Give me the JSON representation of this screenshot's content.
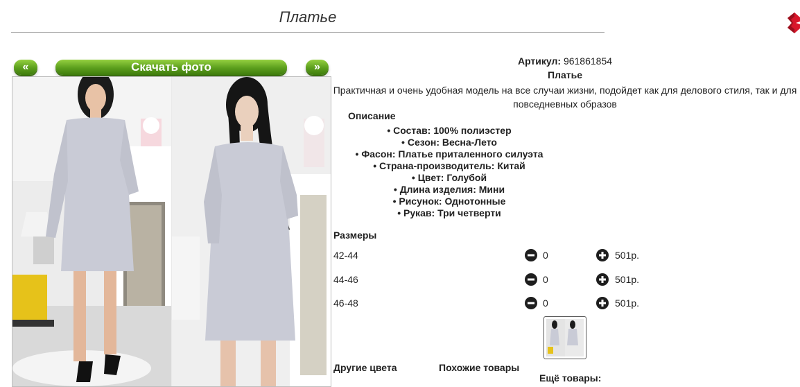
{
  "header": {
    "title": "Платье"
  },
  "gallery": {
    "prev_label": "«",
    "next_label": "»",
    "download_label": "Скачать фото"
  },
  "product": {
    "article_label": "Артикул:",
    "article_value": "961861854",
    "name": "Платье",
    "description": "Практичная и очень удобная модель на все случаи жизни, подойдет как для делового стиля, так и для повседневных образов",
    "description_heading": "Описание",
    "attributes": [
      "Состав: 100% полиэстер",
      "Сезон: Весна-Лето",
      "Фасон: Платье приталенного силуэта",
      "Страна-производитель: Китай",
      "Цвет: Голубой",
      "Длина изделия: Мини",
      "Рисунок: Однотонные",
      "Рукав: Три четверти"
    ]
  },
  "sizes": {
    "heading": "Размеры",
    "rows": [
      {
        "label": "42-44",
        "qty": "0",
        "price": "501р."
      },
      {
        "label": "44-46",
        "qty": "0",
        "price": "501р."
      },
      {
        "label": "46-48",
        "qty": "0",
        "price": "501р."
      }
    ]
  },
  "footer": {
    "other_colors": "Другие цвета",
    "similar": "Похожие товары",
    "more": "Ещё товары:"
  },
  "icons": {
    "close": "close-icon",
    "minus": "minus-circle-icon",
    "plus": "plus-circle-icon"
  },
  "colors": {
    "button_green": "#5b9e1c",
    "close_red": "#d8172b",
    "dress": "#c9cbd6"
  }
}
